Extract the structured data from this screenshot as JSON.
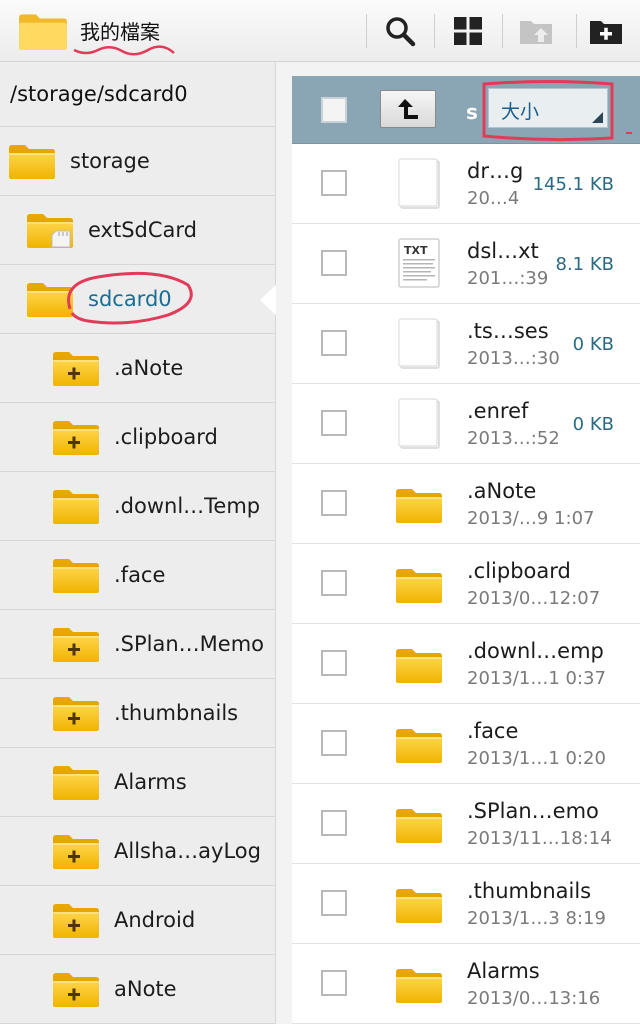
{
  "header": {
    "title": "我的檔案",
    "icons": [
      "folder-icon",
      "search-icon",
      "grid-view-icon",
      "folder-up-icon",
      "add-folder-icon"
    ]
  },
  "tree": {
    "path": "/storage/sdcard0",
    "items": [
      {
        "label": "storage",
        "icon": "folder-icon",
        "indent": 0
      },
      {
        "label": "extSdCard",
        "icon": "sdcard-folder-icon",
        "indent": 1
      },
      {
        "label": "sdcard0",
        "icon": "folder-icon",
        "indent": 1,
        "selected": true
      },
      {
        "label": ".aNote",
        "icon": "folder-plus-icon",
        "indent": 2
      },
      {
        "label": ".clipboard",
        "icon": "folder-plus-icon",
        "indent": 2
      },
      {
        "label": ".downl…Temp",
        "icon": "folder-icon",
        "indent": 2
      },
      {
        "label": ".face",
        "icon": "folder-icon",
        "indent": 2
      },
      {
        "label": ".SPlan…Memo",
        "icon": "folder-plus-icon",
        "indent": 2
      },
      {
        "label": ".thumbnails",
        "icon": "folder-plus-icon",
        "indent": 2
      },
      {
        "label": "Alarms",
        "icon": "folder-icon",
        "indent": 2
      },
      {
        "label": "Allsha…ayLog",
        "icon": "folder-plus-icon",
        "indent": 2
      },
      {
        "label": "Android",
        "icon": "folder-plus-icon",
        "indent": 2
      },
      {
        "label": "aNote",
        "icon": "folder-plus-icon",
        "indent": 2
      }
    ]
  },
  "list": {
    "header_letter": "s",
    "sort_label": "大小",
    "files": [
      {
        "name": "dr…g",
        "date": "20…4",
        "size": "145.1 KB",
        "type": "file"
      },
      {
        "name": "dsl…xt",
        "date": "201…:39",
        "size": "8.1 KB",
        "type": "txt"
      },
      {
        "name": ".ts…ses",
        "date": "2013…:30",
        "size": "0 KB",
        "type": "file"
      },
      {
        "name": ".enref",
        "date": "2013…:52",
        "size": "0 KB",
        "type": "file"
      },
      {
        "name": ".aNote",
        "date": "2013/…9 1:07",
        "size": "",
        "type": "folder"
      },
      {
        "name": ".clipboard",
        "date": "2013/0…12:07",
        "size": "",
        "type": "folder"
      },
      {
        "name": ".downl…emp",
        "date": "2013/1…1 0:37",
        "size": "",
        "type": "folder"
      },
      {
        "name": ".face",
        "date": "2013/1…1 0:20",
        "size": "",
        "type": "folder"
      },
      {
        "name": ".SPlan…emo",
        "date": "2013/11…18:14",
        "size": "",
        "type": "folder"
      },
      {
        "name": ".thumbnails",
        "date": "2013/1…3 8:19",
        "size": "",
        "type": "folder"
      },
      {
        "name": "Alarms",
        "date": "2013/0…13:16",
        "size": "",
        "type": "folder"
      }
    ]
  },
  "colors": {
    "accent": "#1a6e96",
    "header_bar": "#8aa6b4",
    "annotation": "#e23b5a",
    "folder": "#f5c21b"
  }
}
